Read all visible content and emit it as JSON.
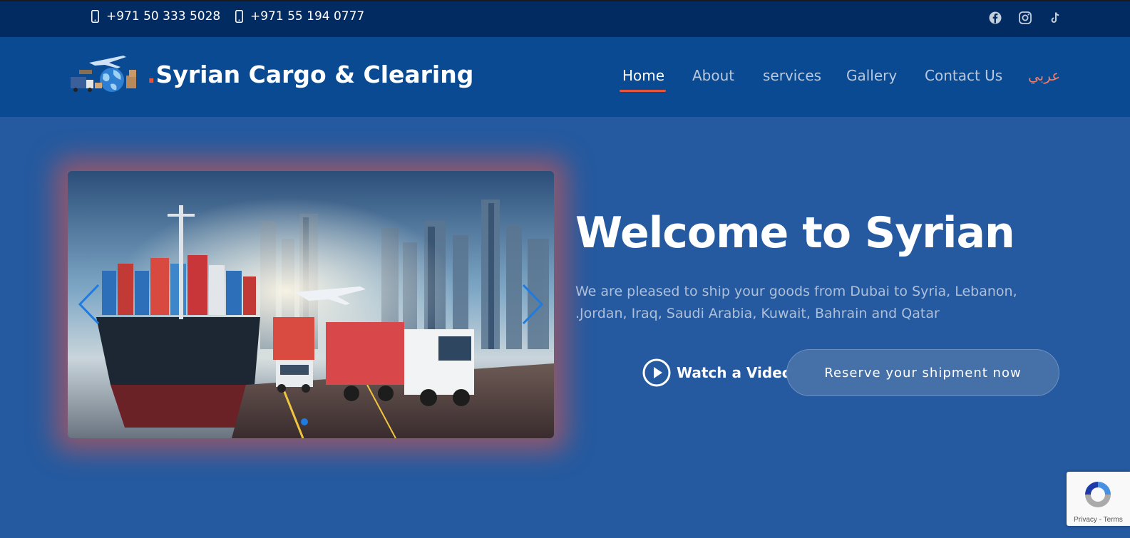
{
  "topbar": {
    "phone1": "+971 50 333 5028",
    "phone2": "+971 55 194 0777",
    "social_icons": [
      "facebook-icon",
      "instagram-icon",
      "tiktok-icon"
    ]
  },
  "header": {
    "brand_dot": ".",
    "brand_name": "Syrian Cargo & Clearing",
    "nav": {
      "home": "Home",
      "about": "About",
      "services": "services",
      "gallery": "Gallery",
      "contact": "Contact Us",
      "language": "عربي"
    },
    "active_nav": "Home"
  },
  "hero": {
    "title": "Welcome to Syrian",
    "text": ".We are pleased to ship your goods from Dubai to Syria, Lebanon, Jordan, Iraq, Saudi Arabia, Kuwait, Bahrain and Qatar",
    "text_line1": "We are pleased to ship your goods from Dubai to Syria, Lebanon,",
    "text_line2": ".Jordan, Iraq, Saudi Arabia, Kuwait, Bahrain and Qatar",
    "watch_label": "Watch a Video",
    "reserve_label": "Reserve your shipment now"
  },
  "slider": {
    "slide_count": 1,
    "active_slide": 1
  },
  "recaptcha": {
    "privacy": "Privacy",
    "separator": " - ",
    "terms": "Terms"
  },
  "colors": {
    "topbar": "#022b62",
    "header": "#094a93",
    "hero_bg": "#255aa0",
    "accent": "#e8553d",
    "slider_glow": "#e85846"
  }
}
